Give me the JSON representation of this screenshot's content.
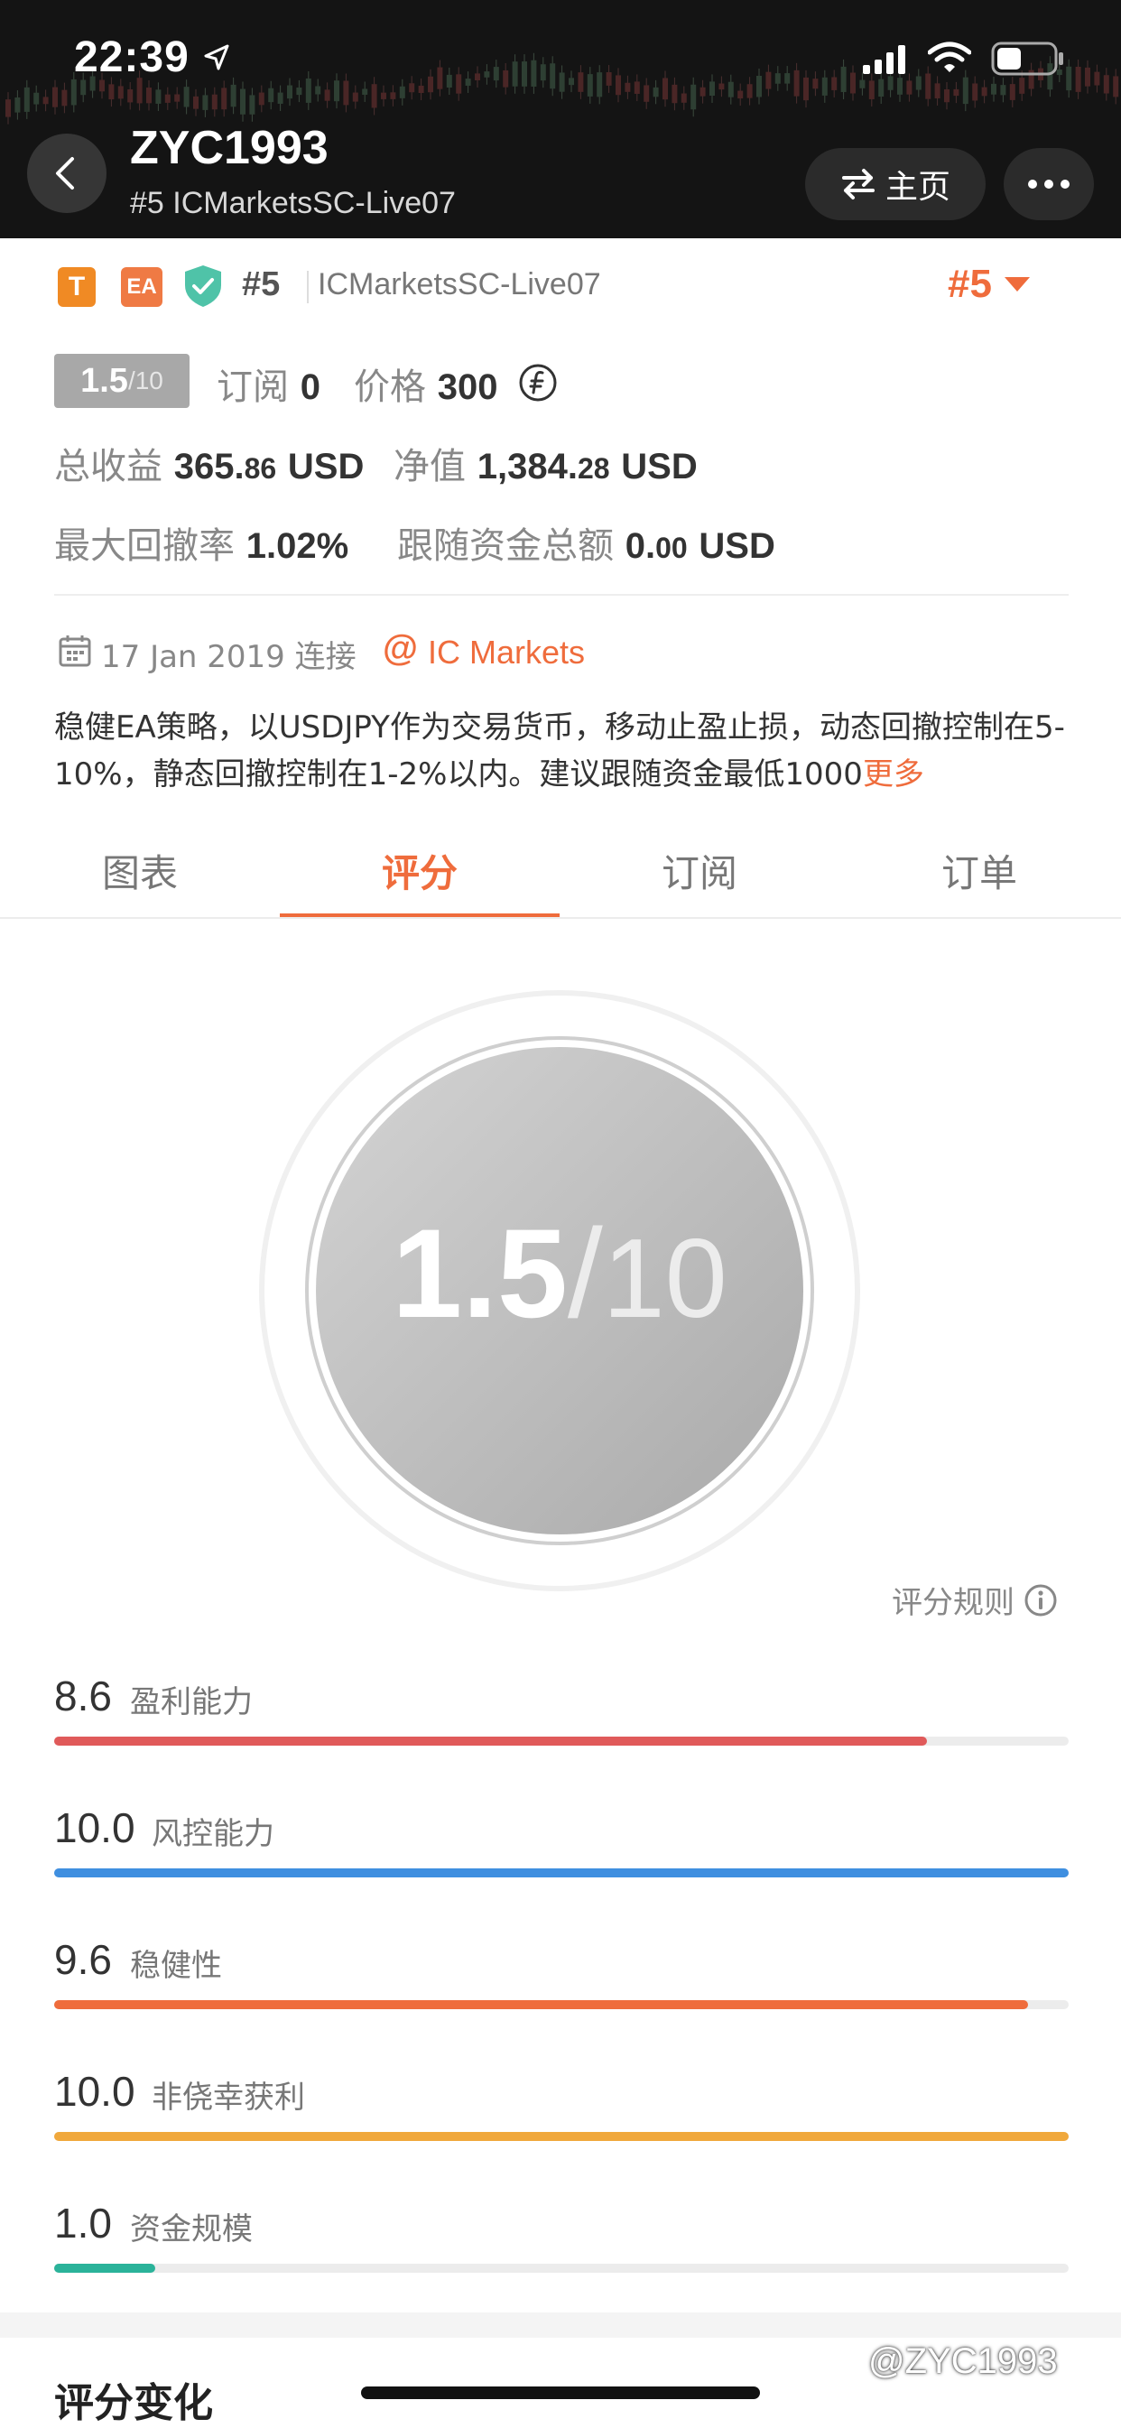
{
  "status_bar": {
    "time": "22:39"
  },
  "header": {
    "title": "ZYC1993",
    "subtitle": "#5 ICMarketsSC-Live07",
    "home_label": "主页"
  },
  "info": {
    "badge_t": "T",
    "badge_ea": "EA",
    "rank": "#5",
    "server": "ICMarketsSC-Live07",
    "rank_dropdown": "#5",
    "score_pill": {
      "value": "1.5",
      "max": "/10"
    },
    "subscribe_label": "订阅",
    "subscribe_count": "0",
    "price_label": "价格",
    "price_value": "300",
    "total_profit_label": "总收益",
    "total_profit_int": "365.",
    "total_profit_dec": "86",
    "total_profit_unit": "USD",
    "equity_label": "净值",
    "equity_int": "1,384.",
    "equity_dec": "28",
    "equity_unit": "USD",
    "max_drawdown_label": "最大回撤率",
    "max_drawdown_value": "1.02%",
    "follow_funds_label": "跟随资金总额",
    "follow_funds_int": "0.",
    "follow_funds_dec": "00",
    "follow_funds_unit": "USD",
    "connected_since": "17 Jan 2019 连接",
    "broker_at": "@",
    "broker": "IC Markets",
    "description": "稳健EA策略，以USDJPY作为交易货币，移动止盈止损，动态回撤控制在5-10%，静态回撤控制在1-2%以内。建议跟随资金最低1000",
    "more_link": "更多"
  },
  "tabs": [
    {
      "label": "图表"
    },
    {
      "label": "评分"
    },
    {
      "label": "订阅"
    },
    {
      "label": "订单"
    }
  ],
  "score": {
    "value": "1.5",
    "slash": "/",
    "max": "10",
    "fraction": 0.15
  },
  "rules_label": "评分规则",
  "metrics": [
    {
      "value": "8.6",
      "label": "盈利能力",
      "fraction": 0.86,
      "color": "#e05a5a"
    },
    {
      "value": "10.0",
      "label": "风控能力",
      "fraction": 1.0,
      "color": "#3f8fe0"
    },
    {
      "value": "9.6",
      "label": "稳健性",
      "fraction": 0.96,
      "color": "#ef6c3c"
    },
    {
      "value": "10.0",
      "label": "非侥幸获利",
      "fraction": 1.0,
      "color": "#f0a83c"
    },
    {
      "value": "1.0",
      "label": "资金规模",
      "fraction": 0.1,
      "color": "#2bb39a"
    }
  ],
  "section_title": "评分变化",
  "watermark": "@ZYC1993",
  "colors": {
    "accent": "#ef6c3c",
    "header_bg": "#141414"
  }
}
